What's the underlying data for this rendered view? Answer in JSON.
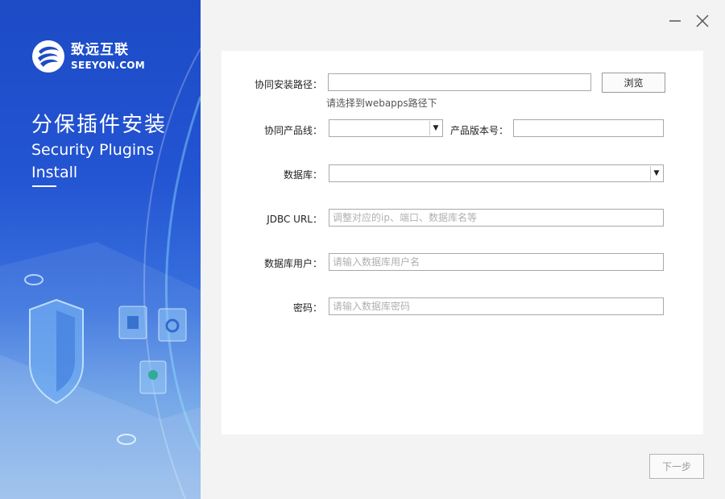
{
  "brand": {
    "name_cn": "致远互联",
    "name_en": "SEEYON.COM",
    "title_cn": "分保插件安装",
    "title_en": "Security Plugins Install"
  },
  "window": {
    "minimize_icon": "minimize-icon",
    "close_icon": "close-icon"
  },
  "form": {
    "install_path": {
      "label": "协同安装路径：",
      "value": "",
      "hint": "请选择到webapps路径下"
    },
    "browse_label": "浏览",
    "product_line": {
      "label": "协同产品线：",
      "value": ""
    },
    "product_version": {
      "label": "产品版本号：",
      "value": ""
    },
    "database": {
      "label": "数据库：",
      "value": ""
    },
    "jdbc_url": {
      "label": "JDBC URL：",
      "placeholder": "调整对应的ip、端口、数据库名等"
    },
    "db_user": {
      "label": "数据库用户：",
      "placeholder": "请输入数据库用户名"
    },
    "password": {
      "label": "密码：",
      "placeholder": "请输入数据库密码"
    }
  },
  "footer": {
    "next_label": "下一步"
  },
  "colors": {
    "brand_blue": "#1d4bc6",
    "card_bg": "#ffffff",
    "page_bg": "#f3f3f3"
  }
}
